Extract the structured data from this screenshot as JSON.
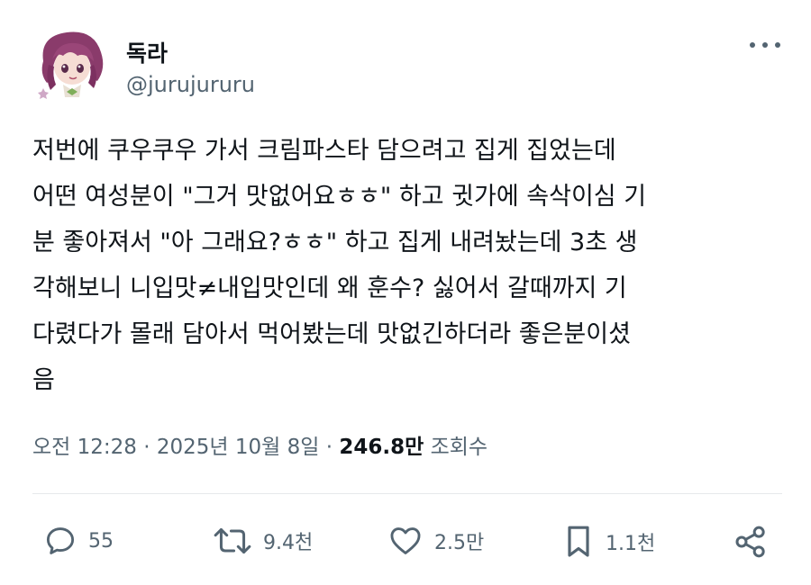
{
  "author": {
    "display_name": "독라",
    "handle": "@jurujururu",
    "avatar_icon": "anime-character-avatar"
  },
  "tweet": {
    "lines": [
      "저번에 쿠우쿠우 가서 크림파스타 담으려고 집게 집었는데",
      "어떤 여성분이 \"그거 맛없어요ㅎㅎ\" 하고 귓가에 속삭이심 기",
      "분 좋아져서 \"아 그래요?ㅎㅎ\" 하고 집게 내려놨는데 3초 생",
      "각해보니 니입맛≠내입맛인데 왜 훈수? 싫어서 갈때까지 기",
      "다렸다가 몰래 담아서 먹어봤는데 맛없긴하더라 좋은분이셨",
      "음"
    ]
  },
  "meta": {
    "time": "오전 12:28",
    "separator": "·",
    "date": "2025년 10월 8일",
    "views_count": "246.8만",
    "views_label": "조회수"
  },
  "actions": {
    "replies": "55",
    "reposts": "9.4천",
    "likes": "2.5만",
    "bookmarks": "1.1천"
  },
  "colors": {
    "text": "#0f1419",
    "secondary": "#536471",
    "divider": "#e6e9eb"
  }
}
